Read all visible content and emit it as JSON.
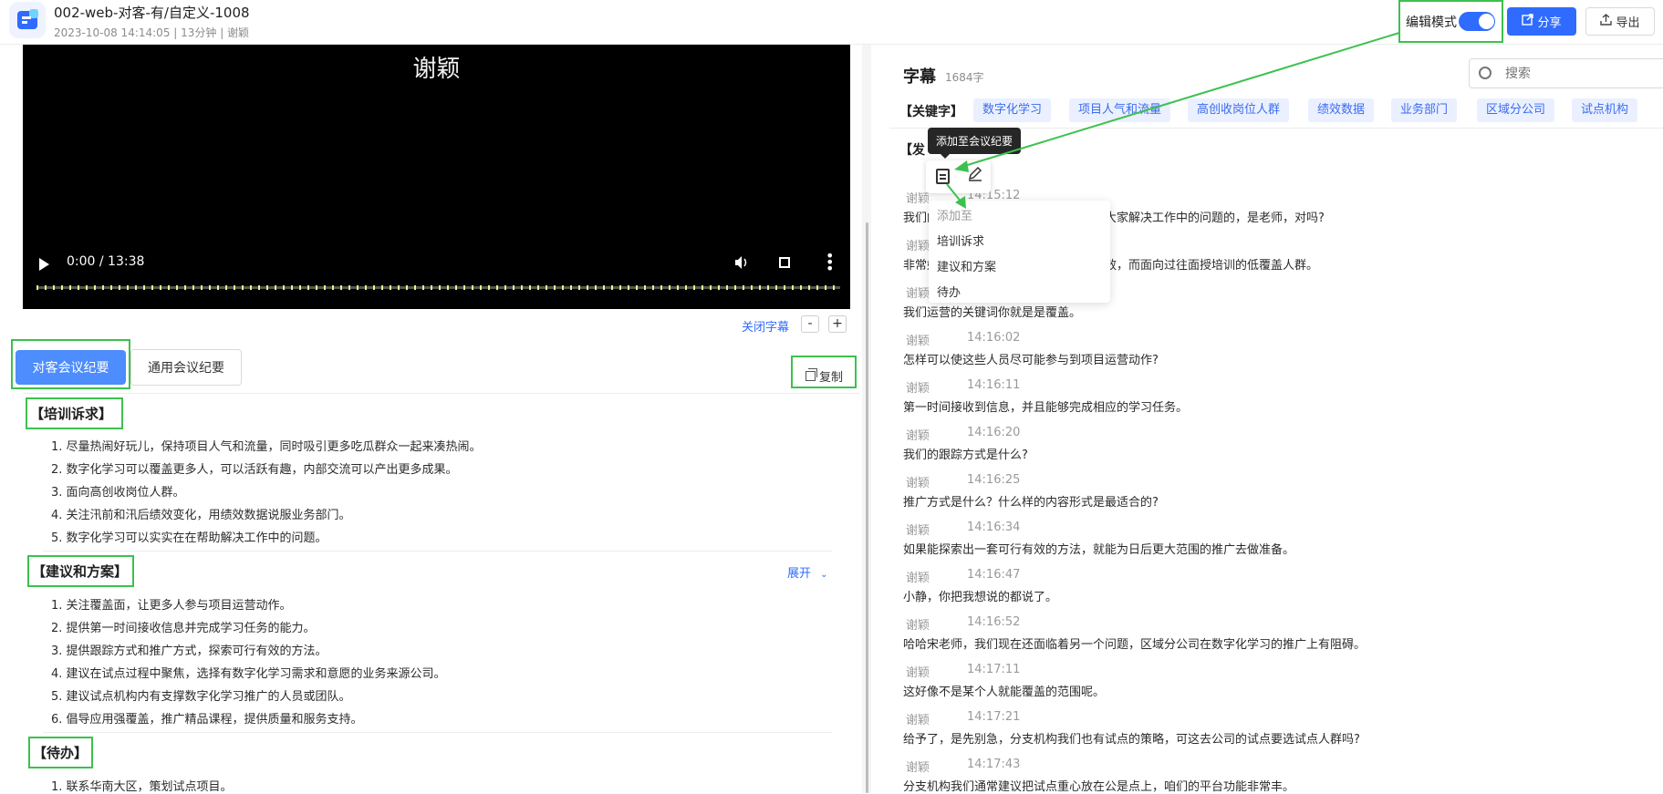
{
  "header": {
    "title": "002-web-对客-有/自定义-1008",
    "meta": "2023-10-08 14:14:05 | 13分钟 | 谢颖",
    "edit_mode_label": "编辑模式",
    "share_label": "分享",
    "export_label": "导出"
  },
  "video": {
    "caption": "谢颖",
    "time": "0:00 / 13:38"
  },
  "subtitle_controls": {
    "toggle_label": "关闭字幕",
    "minus": "-",
    "plus": "+"
  },
  "tabs": [
    {
      "label": "对客会议纪要"
    },
    {
      "label": "通用会议纪要"
    }
  ],
  "copy_label": "复制",
  "expand_label": "展开",
  "sections": [
    {
      "title": "【培训诉求】",
      "items": [
        "1. 尽量热闹好玩儿，保持项目人气和流量，同时吸引更多吃瓜群众一起来凑热闹。",
        "2. 数字化学习可以覆盖更多人，可以活跃有趣，内部交流可以产出更多成果。",
        "3. 面向高创收岗位人群。",
        "4. 关注汛前和汛后绩效变化，用绩效数据说服业务部门。",
        "5. 数字化学习可以实实在在帮助解决工作中的问题。"
      ]
    },
    {
      "title": "【建议和方案】",
      "items": [
        "1. 关注覆盖面，让更多人参与项目运营动作。",
        "2. 提供第一时间接收信息并完成学习任务的能力。",
        "3. 提供跟踪方式和推广方式，探索可行有效的方法。",
        "4. 建议在试点过程中聚焦，选择有数字化学习需求和意愿的业务来源公司。",
        "5. 建议试点机构内有支撑数字化学习推广的人员或团队。",
        "6. 倡导应用强覆盖，推广精品课程，提供质量和服务支持。"
      ]
    },
    {
      "title": "【待办】",
      "items": [
        "1. 联系华南大区，策划试点项目。"
      ]
    }
  ],
  "subtitles": {
    "title": "字幕",
    "count": "1684字",
    "search_placeholder": "搜索",
    "keywords_label": "【关键字】",
    "keywords": [
      "数字化学习",
      "项目人气和流量",
      "高创收岗位人群",
      "绩效数据",
      "业务部门",
      "区域分公司",
      "试点机构"
    ],
    "speaker_label": "【发",
    "entries": [
      {
        "speaker": "谢颖",
        "time": "14:15:12",
        "text": "我们的数字化学习可以实实在在的帮助大家解决工作中的问题的，是老师，对吗?"
      },
      {
        "speaker": "谢颖",
        "time": "",
        "text": "非常好，那么我们的第二个关键词是绩效，而面向过往面授培训的低覆盖人群。"
      },
      {
        "speaker": "谢颖",
        "time": "",
        "text": "我们运营的关键词你就是是覆盖。"
      },
      {
        "speaker": "谢颖",
        "time": "14:16:02",
        "text": "怎样可以使这些人员尽可能参与到项目运营动作?"
      },
      {
        "speaker": "谢颖",
        "time": "14:16:11",
        "text": "第一时间接收到信息，并且能够完成相应的学习任务。"
      },
      {
        "speaker": "谢颖",
        "time": "14:16:20",
        "text": "我们的跟踪方式是什么?"
      },
      {
        "speaker": "谢颖",
        "time": "14:16:25",
        "text": "推广方式是什么？什么样的内容形式是最适合的?"
      },
      {
        "speaker": "谢颖",
        "time": "14:16:34",
        "text": "如果能探索出一套可行有效的方法，就能为日后更大范围的推广去做准备。"
      },
      {
        "speaker": "谢颖",
        "time": "14:16:47",
        "text": "小静，你把我想说的都说了。"
      },
      {
        "speaker": "谢颖",
        "time": "14:16:52",
        "text": "哈哈宋老师，我们现在还面临着另一个问题，区域分公司在数字化学习的推广上有阻碍。"
      },
      {
        "speaker": "谢颖",
        "time": "14:17:11",
        "text": "这好像不是某个人就能覆盖的范围呢。"
      },
      {
        "speaker": "谢颖",
        "time": "14:17:21",
        "text": "给予了，是先别急，分支机构我们也有试点的策略，可这去公司的试点要选试点人群吗?"
      },
      {
        "speaker": "谢颖",
        "time": "14:17:43",
        "text": "分支机构我们通常建议把试点重心放在公是点上，咱们的平台功能非常丰。"
      }
    ]
  },
  "popup": {
    "tooltip": "添加至会议纪要",
    "menu_title": "添加至",
    "menu_items": [
      "培训诉求",
      "建议和方案",
      "待办"
    ]
  },
  "colors": {
    "accent": "#2f6bff",
    "highlight": "#3cc14e",
    "tab_active": "#4d8dfd",
    "keyword_bg": "#eaf0ff"
  }
}
